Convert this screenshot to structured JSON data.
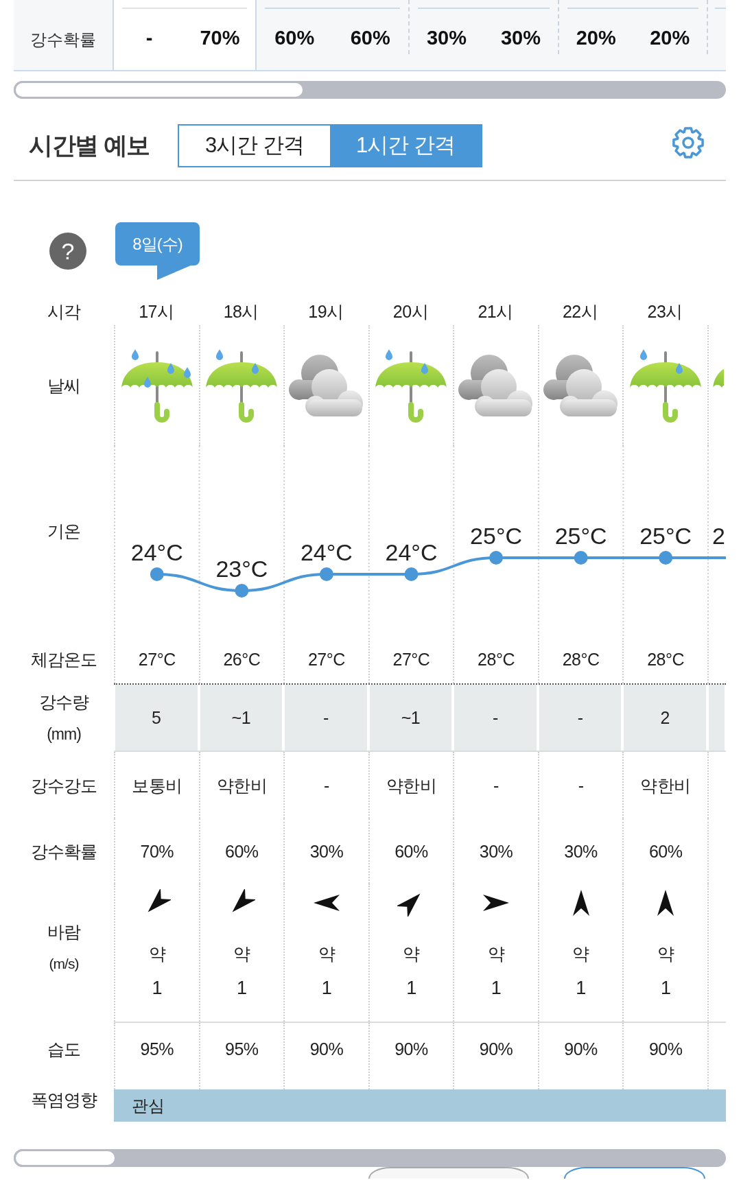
{
  "daily_strip": {
    "label": "강수확률",
    "days": [
      {
        "selected": true,
        "values": [
          "-",
          "70%"
        ]
      },
      {
        "selected": false,
        "values": [
          "60%",
          "60%"
        ]
      },
      {
        "selected": false,
        "values": [
          "30%",
          "30%"
        ]
      },
      {
        "selected": false,
        "values": [
          "20%",
          "20%"
        ]
      }
    ]
  },
  "hourly": {
    "title": "시간별 예보",
    "interval_tabs": [
      {
        "label": "3시간 간격",
        "selected": false
      },
      {
        "label": "1시간 간격",
        "selected": true
      }
    ],
    "help": "?",
    "date_tag": "8일(수)",
    "rows": [
      {
        "kind": "time",
        "label": "시각"
      },
      {
        "kind": "weather",
        "label": "날씨"
      },
      {
        "kind": "temperature",
        "label": "기온"
      },
      {
        "kind": "feels_like",
        "label": "체감온도"
      },
      {
        "kind": "precipitation",
        "label": "강수량",
        "unit": "(mm)"
      },
      {
        "kind": "intensity",
        "label": "강수강도"
      },
      {
        "kind": "probability",
        "label": "강수확률"
      },
      {
        "kind": "wind",
        "label": "바람",
        "unit": "(m/s)"
      },
      {
        "kind": "humidity",
        "label": "습도"
      },
      {
        "kind": "heat_impact",
        "label": "폭염영향",
        "value": "관심"
      }
    ],
    "hours": [
      {
        "time": "17시",
        "weather": {
          "kind": "rain"
        },
        "temperature": "24°C",
        "feels_like": "27°C",
        "precipitation": "5",
        "intensity": "보통비",
        "probability": "70%",
        "wind_arrow": {
          "kind": "southwest"
        },
        "wind_strength": "약",
        "wind_speed": "1",
        "humidity": "95%"
      },
      {
        "time": "18시",
        "weather": {
          "kind": "light_rain"
        },
        "temperature": "23°C",
        "feels_like": "26°C",
        "precipitation": "~1",
        "intensity": "약한비",
        "probability": "60%",
        "wind_arrow": {
          "kind": "southwest"
        },
        "wind_strength": "약",
        "wind_speed": "1",
        "humidity": "95%"
      },
      {
        "time": "19시",
        "weather": {
          "kind": "cloudy"
        },
        "temperature": "24°C",
        "feels_like": "27°C",
        "precipitation": "-",
        "intensity": "-",
        "probability": "30%",
        "wind_arrow": {
          "kind": "west"
        },
        "wind_strength": "약",
        "wind_speed": "1",
        "humidity": "90%"
      },
      {
        "time": "20시",
        "weather": {
          "kind": "light_rain"
        },
        "temperature": "24°C",
        "feels_like": "27°C",
        "precipitation": "~1",
        "intensity": "약한비",
        "probability": "60%",
        "wind_arrow": {
          "kind": "northeast"
        },
        "wind_strength": "약",
        "wind_speed": "1",
        "humidity": "90%"
      },
      {
        "time": "21시",
        "weather": {
          "kind": "cloudy"
        },
        "temperature": "25°C",
        "feels_like": "28°C",
        "precipitation": "-",
        "intensity": "-",
        "probability": "30%",
        "wind_arrow": {
          "kind": "east"
        },
        "wind_strength": "약",
        "wind_speed": "1",
        "humidity": "90%"
      },
      {
        "time": "22시",
        "weather": {
          "kind": "cloudy"
        },
        "temperature": "25°C",
        "feels_like": "28°C",
        "precipitation": "-",
        "intensity": "-",
        "probability": "30%",
        "wind_arrow": {
          "kind": "north"
        },
        "wind_strength": "약",
        "wind_speed": "1",
        "humidity": "90%"
      },
      {
        "time": "23시",
        "weather": {
          "kind": "light_rain"
        },
        "temperature": "25°C",
        "feels_like": "28°C",
        "precipitation": "2",
        "intensity": "약한비",
        "probability": "60%",
        "wind_arrow": {
          "kind": "north"
        },
        "wind_strength": "약",
        "wind_speed": "1",
        "humidity": "90%"
      }
    ],
    "cut_column": {
      "weather": {
        "kind": "light_rain"
      },
      "temperature": "2"
    }
  }
}
